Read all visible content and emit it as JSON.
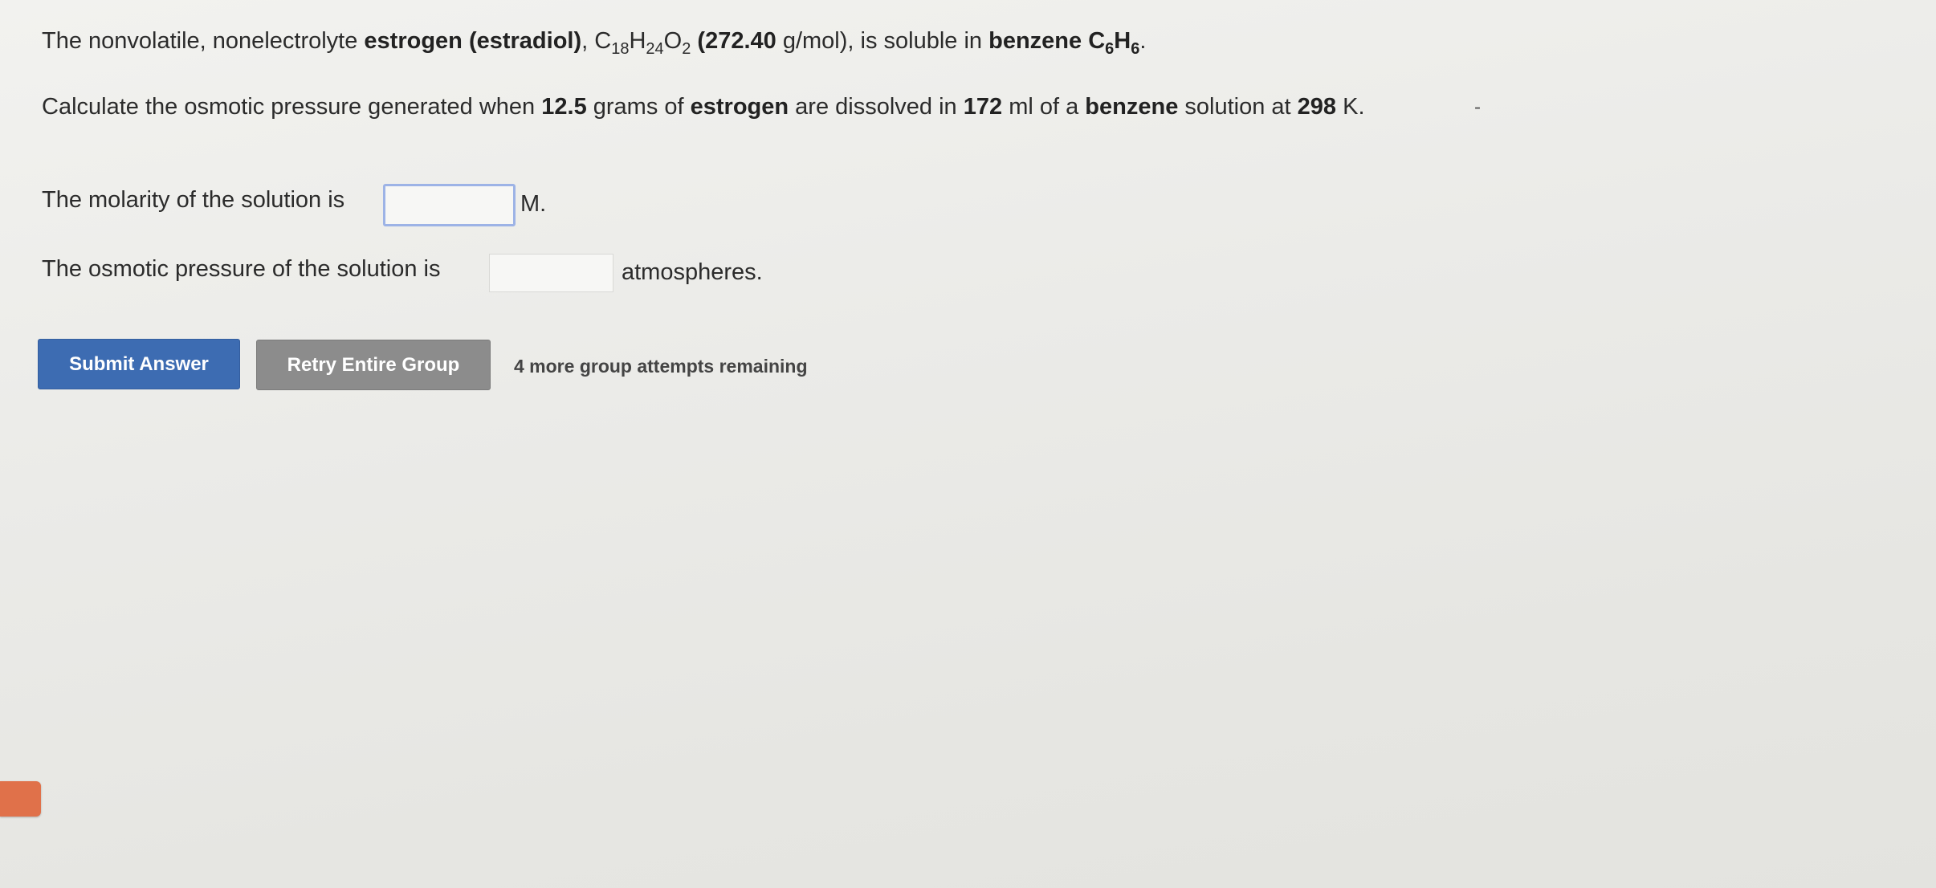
{
  "question": {
    "line1": {
      "intro": "The nonvolatile, nonelectrolyte ",
      "compound_name": "estrogen (estradiol)",
      "sep": ", ",
      "formula": {
        "e1": "C",
        "n1": "18",
        "e2": "H",
        "n2": "24",
        "e3": "O",
        "n3": "2"
      },
      "molar_mass_value": " (272.40",
      "molar_mass_unit": " g/mol), is soluble in ",
      "solvent_name": "benzene",
      "solvent_formula": {
        "e1": "C",
        "n1": "6",
        "e2": "H",
        "n2": "6"
      },
      "end": "."
    },
    "line2": {
      "t1": "Calculate the osmotic pressure generated when ",
      "mass": "12.5",
      "t2": " grams of ",
      "solute": "estrogen",
      "t3": " are dissolved in ",
      "volume": "172",
      "t4": " ml of a ",
      "solvent": "benzene",
      "t5": " solution at ",
      "temp": "298",
      "t6": " K."
    },
    "dash": "-"
  },
  "answers": {
    "molarity_label": "The molarity of the solution is",
    "molarity_value": "",
    "molarity_unit": "M.",
    "pressure_label": "The osmotic pressure of the solution is",
    "pressure_value": "",
    "pressure_unit": "atmospheres."
  },
  "buttons": {
    "submit_label": "Submit Answer",
    "retry_label": "Retry Entire Group",
    "attempts_text": "4 more group attempts remaining"
  },
  "colors": {
    "submit_bg": "#3d6cb2",
    "retry_bg": "#8c8c8c",
    "active_input_border": "#9db3e6",
    "side_tab": "#e0714a"
  }
}
